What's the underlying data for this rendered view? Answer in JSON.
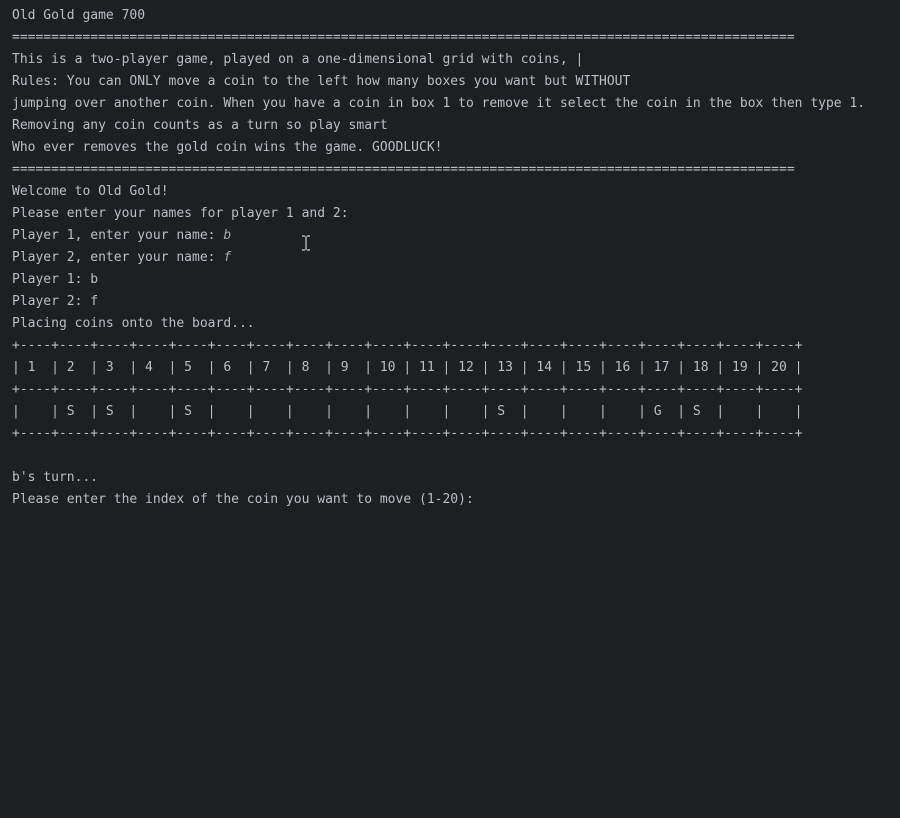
{
  "console": {
    "title": "Old Gold game 700",
    "separator_top": "====================================================================================================",
    "intro": "This is a two-player game, played on a one-dimensional grid with coins, |",
    "rules": [
      "Rules: You can ONLY move a coin to the left how many boxes you want but WITHOUT",
      "jumping over another coin. When you have a coin in box 1 to remove it select the coin in the box then type 1.",
      "Removing any coin counts as a turn so play smart",
      "Who ever removes the gold coin wins the game. GOODLUCK!"
    ],
    "separator_bottom": "====================================================================================================",
    "welcome": "Welcome to Old Gold!",
    "names_prompt": "Please enter your names for player 1 and 2:",
    "p1_prompt": "Player 1, enter your name: ",
    "p1_input": "b",
    "p2_prompt": "Player 2, enter your name: ",
    "p2_input": "f",
    "p1_confirm": "Player 1: b",
    "p2_confirm": "Player 2: f",
    "placing": "Placing coins onto the board...",
    "board": {
      "border": "+----+----+----+----+----+----+----+----+----+----+----+----+----+----+----+----+----+----+----+----+",
      "index_row": "| 1  | 2  | 3  | 4  | 5  | 6  | 7  | 8  | 9  | 10 | 11 | 12 | 13 | 14 | 15 | 16 | 17 | 18 | 19 | 20 |",
      "coin_row": "|    | S  | S  |    | S  |    |    |    |    |    |    |    | S  |    |    |    | G  | S  |    |    |"
    },
    "turn": "b's turn...",
    "move_prompt": "Please enter the index of the coin you want to move (1-20):"
  },
  "icons": {
    "cursor": "text-cursor-icon"
  }
}
